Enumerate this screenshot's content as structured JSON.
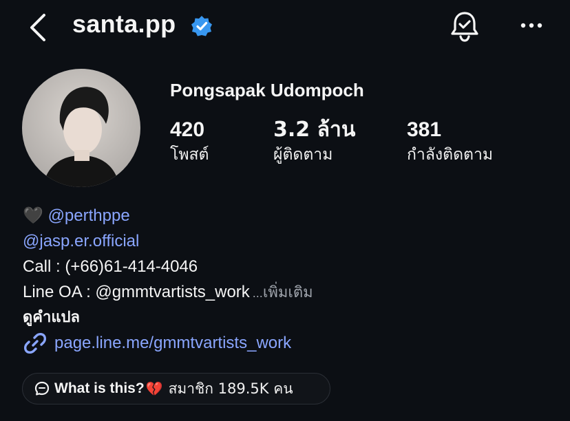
{
  "header": {
    "username": "santa.pp"
  },
  "profile": {
    "full_name": "Pongsapak Udompoch",
    "stats": [
      {
        "value": "420",
        "label": "โพสต์"
      },
      {
        "value": "3.2 ล้าน",
        "label": "ผู้ติดตาม"
      },
      {
        "value": "381",
        "label": "กำลังติดตาม"
      }
    ]
  },
  "bio": {
    "line1_emoji": "🖤",
    "line1_mention": "@perthppe",
    "line2_mention": "@jasp.er.official",
    "line3": "Call : (+66)61-414-4046",
    "line4": "Line OA : @gmmtvartists_work",
    "more_ellipsis": "...",
    "more_label": "เพิ่มเติม",
    "translate_label": "ดูคำแปล",
    "link_url": "page.line.me/gmmtvartists_work"
  },
  "channel": {
    "title": "What is this?",
    "emoji": "💔",
    "members": "สมาชิก 189.5K คน"
  },
  "colors": {
    "background": "#0c0f14",
    "link": "#8aa6ff",
    "verified": "#3897f0"
  }
}
